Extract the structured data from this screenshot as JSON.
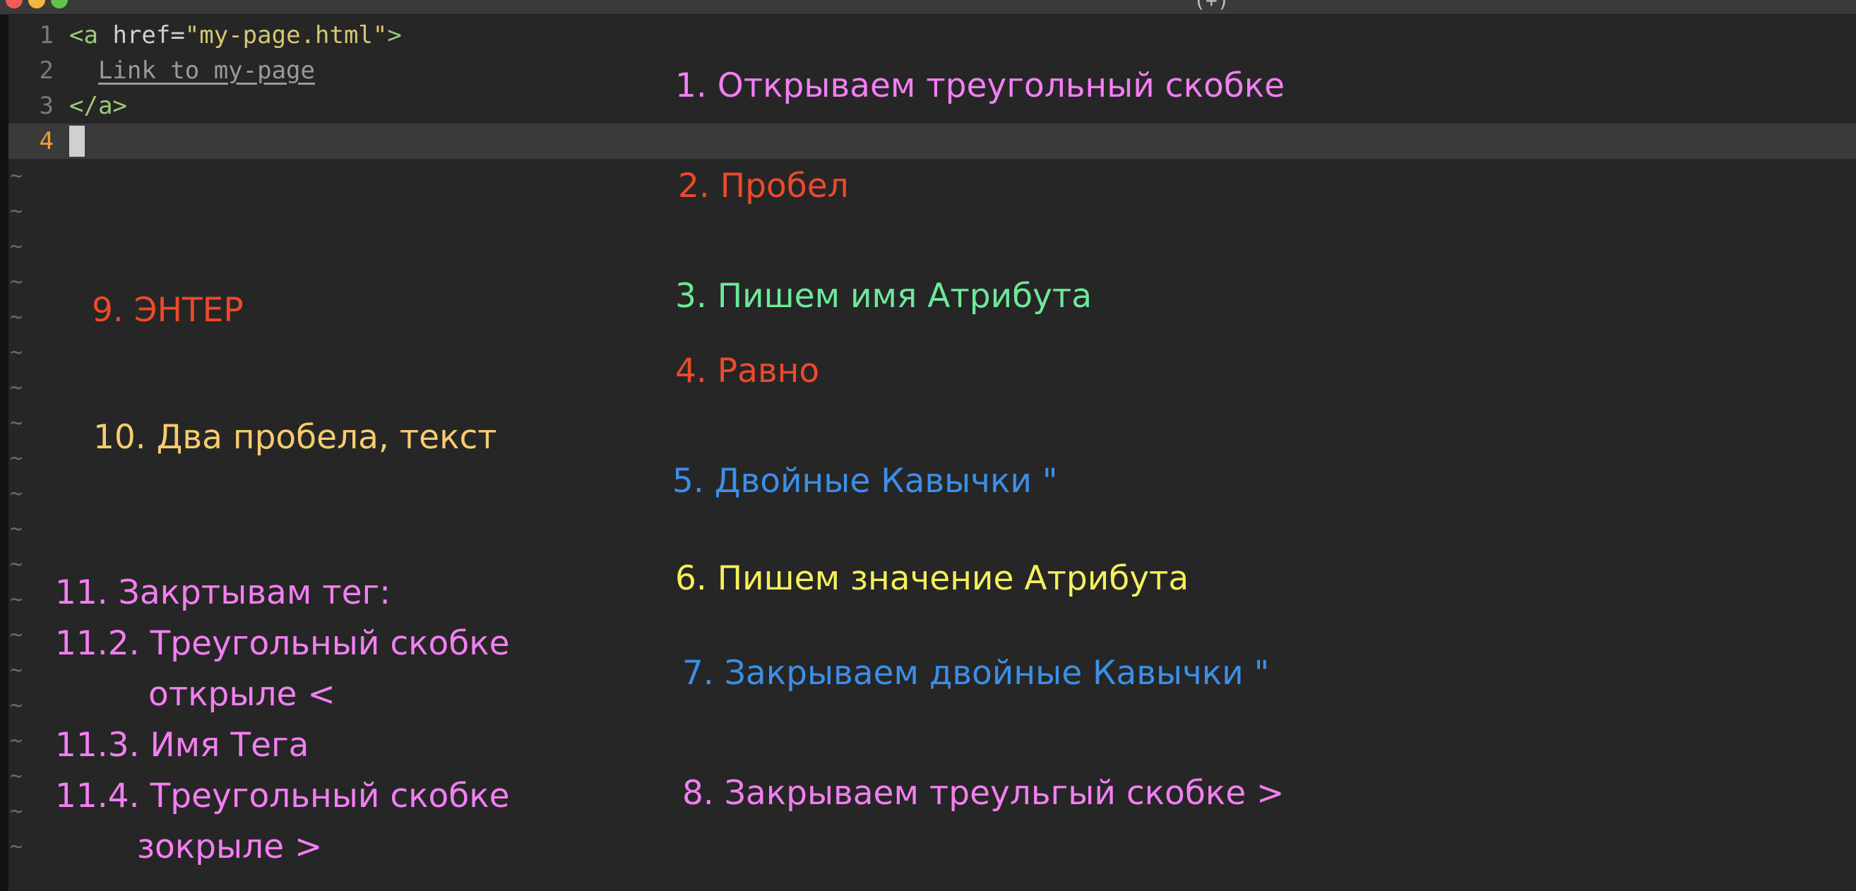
{
  "titlebar": {
    "title_fragment": "(+)"
  },
  "editor": {
    "lines": [
      {
        "num": "1"
      },
      {
        "num": "2",
        "text": "Link to my-page"
      },
      {
        "num": "3"
      },
      {
        "num": "4"
      }
    ],
    "code": {
      "open_tag_lt": "<",
      "open_tag_name": "a",
      "attr_name": " href=",
      "attr_value": "\"my-page.html\"",
      "open_tag_gt": ">",
      "close_tag": "</a>",
      "indent": "  "
    },
    "tilde": "~"
  },
  "annotations": {
    "n1": "1. Открываем треугольный скобке",
    "n2": "2. Пробел",
    "n3": "3. Пишем имя Атрибута",
    "n4": "4. Равно",
    "n5": "5. Двойные Кавычки \"",
    "n6": "6. Пишем значение Атрибута",
    "n7": "7. Закрываем двойные Кавычки \"",
    "n8": "8. Закрываем треульгый скобке >",
    "n9": "9. ЭНТЕР",
    "n10": "10. Два пробела, текст",
    "n11": "11. Закртывам тег:",
    "n11_2a": "11.2. Треугольный скобке",
    "n11_2b": "открыле <",
    "n11_3": "11.3. Имя Тега",
    "n11_4a": "11.4. Треугольный скобке",
    "n11_4b": "зокрыле >"
  },
  "colors": {
    "background": "#262626",
    "current_line": "#3a3a3a",
    "pink": "#f27ff2",
    "red": "#ec4a2b",
    "green": "#6ee89a",
    "blue": "#3b8fe8",
    "yellow": "#f5f05a",
    "orange": "#f6cc6e"
  }
}
